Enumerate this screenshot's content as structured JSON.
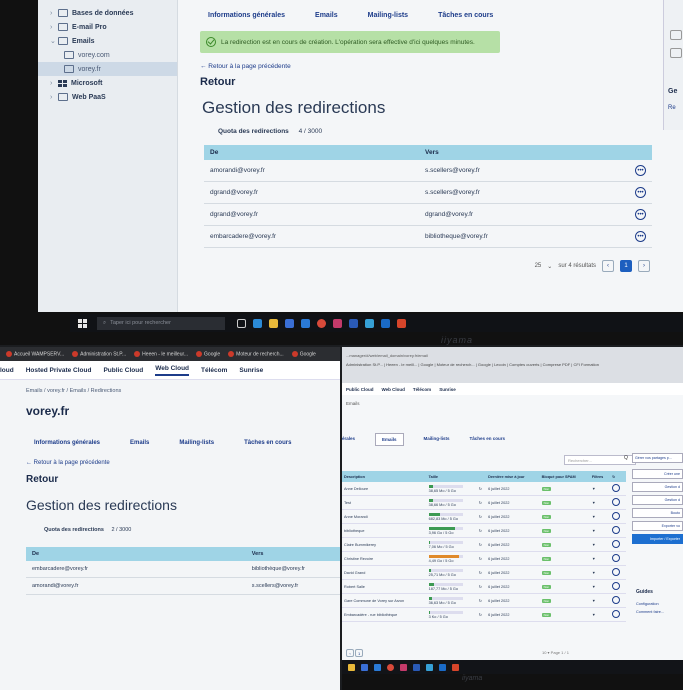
{
  "photo1": {
    "sidebar": [
      {
        "label": "Bases de données",
        "bold": true,
        "chev": "›",
        "sub": false
      },
      {
        "label": "E-mail Pro",
        "bold": true,
        "chev": "›",
        "sub": false
      },
      {
        "label": "Emails",
        "bold": true,
        "chev": "⌄",
        "sub": false
      },
      {
        "label": "vorey.com",
        "bold": false,
        "chev": "",
        "sub": true
      },
      {
        "label": "vorey.fr",
        "bold": false,
        "chev": "",
        "sub": true,
        "active": true
      },
      {
        "label": "Microsoft",
        "bold": true,
        "chev": "›",
        "sub": false
      },
      {
        "label": "Web PaaS",
        "bold": true,
        "chev": "›",
        "sub": false
      }
    ],
    "tabs": [
      "Informations générales",
      "Emails",
      "Mailing-lists",
      "Tâches en cours"
    ],
    "alert": "La redirection est en cours de création. L'opération sera effective d'ici quelques minutes.",
    "back_link": "← Retour à la page précédente",
    "retour": "Retour",
    "heading": "Gestion des redirections",
    "quota_label": "Quota des redirections",
    "quota_value": "4 / 3000",
    "col_from": "De",
    "col_to": "Vers",
    "rows": [
      {
        "from": "amorandi@vorey.fr",
        "to": "s.scellers@vorey.fr"
      },
      {
        "from": "dgrand@vorey.fr",
        "to": "s.scellers@vorey.fr"
      },
      {
        "from": "dgrand@vorey.fr",
        "to": "dgrand@vorey.fr"
      },
      {
        "from": "embarcadere@vorey.fr",
        "to": "bibliotheque@vorey.fr"
      }
    ],
    "pager_size": "25",
    "pager_text": "sur 4 résultats",
    "pager_prev": "‹",
    "pager_page": "1",
    "pager_next": "›",
    "right_title": "Ge",
    "right_link": "Re",
    "taskbar_search": "Taper ici pour rechercher",
    "brand": "iiyama"
  },
  "photo2": {
    "bookmarks": [
      "Accueil WAMPSERV...",
      "Administration St.P...",
      "Heeen - le meilleur...",
      "Google",
      "Moteur de recherch...",
      "Google"
    ],
    "nav": [
      "Hosted Private Cloud",
      "Public Cloud",
      "Web Cloud",
      "Télécom",
      "Sunrise"
    ],
    "nav_prefix": "loud",
    "breadcrumb": "Emails / vorey.fr / Emails / Redirections",
    "title": "vorey.fr",
    "tabs": [
      "Informations générales",
      "Emails",
      "Mailing-lists",
      "Tâches en cours"
    ],
    "back_link": "← Retour à la page précédente",
    "retour": "Retour",
    "heading": "Gestion des redirections",
    "quota_label": "Quota des redirections",
    "quota_value": "2 / 3000",
    "col_from": "De",
    "col_to": "Vers",
    "rows": [
      {
        "from": "embarcadere@vorey.fr",
        "to": "bibliothèque@vorey.fr"
      },
      {
        "from": "amorandi@vorey.fr",
        "to": "s.scellers@vorey.fr"
      }
    ]
  },
  "photo3": {
    "url": "...manager/#/web/email_domain/vorey.fr/email",
    "bookmarks": "Administration St.P... | Heeen - le meill... | Google | Moteur de recherch... | Google | Lecoin | Comptes ouverts | Comprese PDF | CFI Formation",
    "nav": [
      "Public Cloud",
      "Web Cloud",
      "Télécom",
      "Sunrise"
    ],
    "emails_label": "Emails",
    "tabs": [
      "érales",
      "Emails",
      "Mailing-lists",
      "Tâches en cours"
    ],
    "search_placeholder": "Rechercher...",
    "search_icon": "Q",
    "headers": [
      "Description",
      "Taille",
      "",
      "Dernière mise à jour",
      "Bloqué pour SPAM",
      "Filtres",
      "↻"
    ],
    "rows": [
      {
        "desc": "Anne Delloure",
        "size": "38,65 Mo / 5 Go",
        "fill": 0.12,
        "warn": false,
        "date": "6 juillet 2022",
        "flag": "Non"
      },
      {
        "desc": "Test",
        "size": "38,66 Mo / 5 Go",
        "fill": 0.12,
        "warn": false,
        "date": "6 juillet 2022",
        "flag": "Non"
      },
      {
        "desc": "Anne Morandi",
        "size": "682,83 Mo / 5 Go",
        "fill": 0.35,
        "warn": false,
        "date": "6 juillet 2022",
        "flag": "Non"
      },
      {
        "desc": "bibliotheque",
        "size": "3,96 Go / 5 Go",
        "fill": 0.79,
        "warn": false,
        "date": "6 juillet 2022",
        "flag": "Non"
      },
      {
        "desc": "Claire Bummikerey",
        "size": "7,06 Mo / 5 Go",
        "fill": 0.05,
        "warn": false,
        "date": "6 juillet 2022",
        "flag": "Non"
      },
      {
        "desc": "Christine Revoire",
        "size": "4,49 Go / 5 Go",
        "fill": 0.9,
        "warn": true,
        "date": "6 juillet 2022",
        "flag": "Non"
      },
      {
        "desc": "David Grand",
        "size": "25,71 Mo / 5 Go",
        "fill": 0.08,
        "warn": false,
        "date": "6 juillet 2022",
        "flag": "Non"
      },
      {
        "desc": "Robert Salle",
        "size": "187,77 Mo / 5 Go",
        "fill": 0.15,
        "warn": false,
        "date": "6 juillet 2022",
        "flag": "Non"
      },
      {
        "desc": "Gare Commune de Vorey sur Arzon",
        "size": "36,63 Mo / 5 Go",
        "fill": 0.1,
        "warn": false,
        "date": "6 juillet 2022",
        "flag": "Non"
      },
      {
        "desc": "Embarcadère - rue bibliothèque",
        "size": "3 Ko / 5 Go",
        "fill": 0.02,
        "warn": false,
        "date": "6 juillet 2022",
        "flag": "Non"
      }
    ],
    "actions": [
      "Gérer vos partages p...",
      "Créer une",
      "Gestion d",
      "Gestion d",
      "Bouto",
      "Exporter vo",
      "Importer / Exporter"
    ],
    "guides_title": "Guides",
    "guide_links": [
      "Configuration",
      "Comment faire..."
    ],
    "pager_prev": "‹",
    "pager_page": "1",
    "page_select": "10   ▾   Page 1 / 1",
    "brand": "iiyama"
  }
}
